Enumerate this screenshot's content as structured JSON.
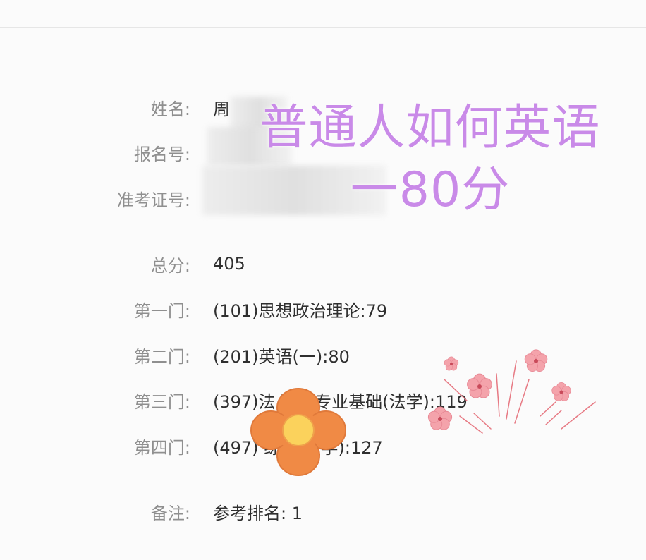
{
  "fields": {
    "name": {
      "label": "姓名:",
      "value": "周"
    },
    "reg_no": {
      "label": "报名号:",
      "value": ""
    },
    "admission_no": {
      "label": "准考证号:",
      "value": ""
    },
    "total": {
      "label": "总分:",
      "value": "405"
    },
    "subject1": {
      "label": "第一门:",
      "value": "(101)思想政治理论:79"
    },
    "subject2": {
      "label": "第二门:",
      "value": "(201)英语(一):80"
    },
    "subject3": {
      "label": "第三门:",
      "value": "(397)法 硕士专业基础(法学):119"
    },
    "subject4": {
      "label": "第四门:",
      "value": "(497) 综合(法学):127"
    },
    "note": {
      "label": "备注:",
      "value": "参考排名: 1"
    }
  },
  "overlay": {
    "line1": "普通人如何英语",
    "line2": "一80分"
  },
  "icons": {
    "decoration": [
      "blossom-icon",
      "orange-flower-icon"
    ]
  },
  "colors": {
    "overlay_text": "#c98ae8",
    "label": "#8f8f8f",
    "value": "#2f2f2f",
    "blossom": "#f4a3ab",
    "orange_flower": "#f08a45"
  }
}
